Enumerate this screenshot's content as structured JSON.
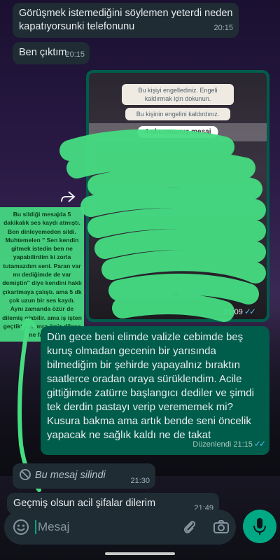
{
  "messages": {
    "m1": {
      "text": "Görüşmek istemediğini söylemen yeterdi neden kapatıyorsunki telefonunu",
      "time": "20:15"
    },
    "m2": {
      "text": "Ben çıktım",
      "time": "20:15"
    },
    "screenshot": {
      "blocked_notice": "Bu kişiyi engellediniz. Engeli kaldırmak için dokunun.",
      "unblocked_notice": "Bu kişinin engelini kaldırdınız.",
      "unread": "4 okunmamış mesaj",
      "time": "21:09"
    },
    "annotation": "Bu sildiği mesajda 5 dakikalık ses kaydı atmıştı. Ben dinleyemeden sildi. Muhtemelen \" Sen kendin gitmek istedin ben ne yapabilirdim ki zorla tutamazdım seni. Paran var mı dediğimde de var demiştin\" diye kendini haklı çıkartmaya çalıştı. ama 5 dk çok uzun bir ses kaydı. Aynı zamanda özür de dilemiş olabilir. ama iş işten geçtikten sonra özür dilese ne fayda.",
    "m3": {
      "text": "Dün gece beni elimde valizle cebimde beş kuruş olmadan gecenin bir yarısında bilmediğim bir şehirde yapayalnız bıraktın saatlerce oradan oraya sürüklendim. Acile gittiğimde zatürre başlangıcı dediler ve şimdi tek derdin pastayı verip verememek mi? Kusura bakma ama artık bende seni öncelik yapacak ne sağlık kaldı ne de takat",
      "edited": "Düzenlendi",
      "time": "21:15"
    },
    "deleted": {
      "text": "Bu mesaj silindi",
      "time": "21:30"
    },
    "m4": {
      "text": "Geçmiş olsun acil şifalar dilerim",
      "time": "21:49"
    }
  },
  "composer": {
    "placeholder": "Mesaj"
  },
  "colors": {
    "incoming": "#1f2c34",
    "outgoing": "#005c4b",
    "accent": "#00a884",
    "ticks": "#53bdeb",
    "highlighter": "#46dc82"
  },
  "icons": [
    "forward-icon",
    "deleted-icon",
    "emoji-icon",
    "attach-icon",
    "camera-icon",
    "mic-icon",
    "read-ticks-icon"
  ]
}
